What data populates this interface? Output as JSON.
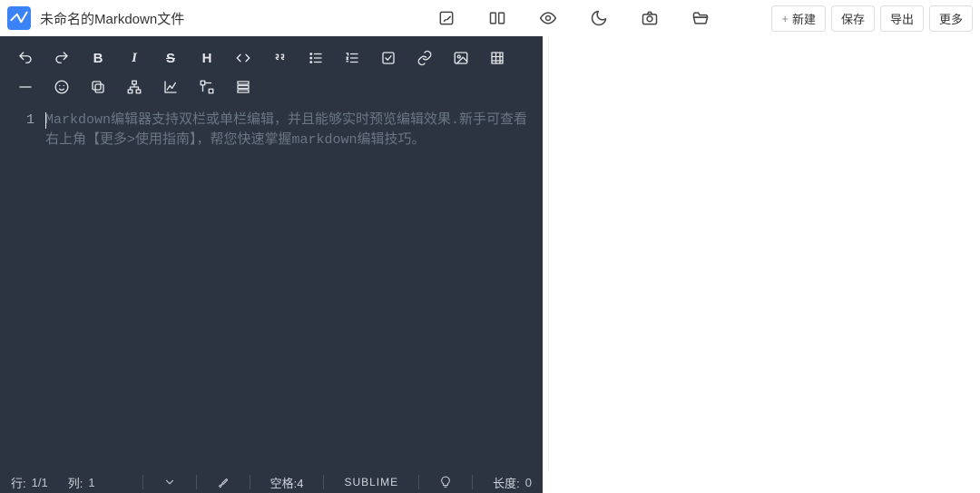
{
  "header": {
    "title": "未命名的Markdown文件",
    "buttons": {
      "new": "新建",
      "save": "保存",
      "export": "导出",
      "more": "更多"
    }
  },
  "toolbar": {
    "bold": "B",
    "italic": "I",
    "strike": "S",
    "heading": "H"
  },
  "editor": {
    "line_number": "1",
    "placeholder": "Markdown编辑器支持双栏或单栏编辑，并且能够实时预览编辑效果.新手可查看右上角【更多>使用指南】，帮您快速掌握markdown编辑技巧。"
  },
  "statusbar": {
    "row_label": "行:",
    "row_value": "1/1",
    "col_label": "列:",
    "col_value": "1",
    "spaces_label": "空格:4",
    "mode": "SUBLIME",
    "length_label": "长度:",
    "length_value": "0"
  }
}
